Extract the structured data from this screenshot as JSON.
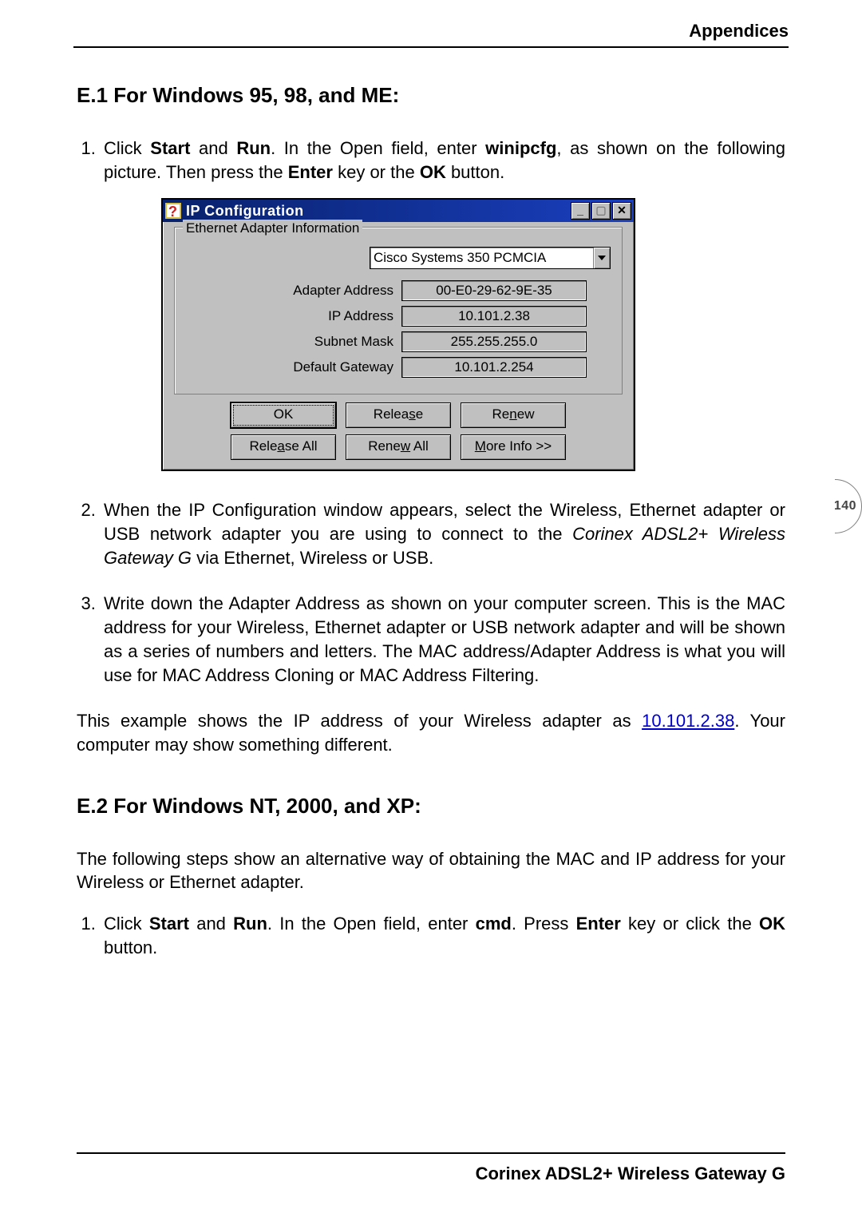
{
  "header": {
    "title": "Appendices"
  },
  "page_number": "140",
  "sections": {
    "e1": {
      "heading": "E.1 For Windows 95, 98, and ME:",
      "step1_pre": "Click ",
      "step1_start": "Start",
      "step1_and": " and ",
      "step1_run": "Run",
      "step1_mid": ". In the Open field, enter ",
      "step1_cmd": "winipcfg",
      "step1_tail": ", as shown on the following picture. Then press the ",
      "step1_enter": "Enter",
      "step1_tail2": " key or the ",
      "step1_ok": "OK",
      "step1_tail3": " button.",
      "step2_a": "When the IP Configuration window appears, select the Wireless, Ethernet adapter or USB network adapter you are using to connect to the ",
      "step2_em": "Corinex ADSL2+ Wireless Gateway G",
      "step2_b": " via Ethernet, Wireless or USB.",
      "step3": "Write down the Adapter Address as shown on your computer screen. This is the MAC address for your Wireless, Ethernet adapter or USB network adapter and will be shown as a series of numbers and letters. The MAC address/Adapter Address is what you will use for MAC Address Cloning or MAC Address Filtering.",
      "example_a": "This example shows the IP address of your Wireless adapter as ",
      "example_ip": "10.101.2.38",
      "example_b": ". Your computer may show something different."
    },
    "e2": {
      "heading": "E.2 For Windows NT, 2000, and XP:",
      "intro": "The following steps show an alternative way of obtaining the MAC and IP address for your Wireless or Ethernet adapter.",
      "step1_pre": "Click ",
      "step1_start": "Start",
      "step1_and": " and ",
      "step1_run": "Run",
      "step1_mid": ". In the Open field, enter ",
      "step1_cmd": "cmd",
      "step1_tail": ". Press ",
      "step1_enter": "Enter",
      "step1_tail2": " key or click the ",
      "step1_ok": "OK",
      "step1_tail3": " button."
    }
  },
  "dialog": {
    "title": "IP Configuration",
    "group_legend": "Ethernet Adapter Information",
    "adapter_selected": "Cisco Systems 350 PCMCIA",
    "fields": {
      "adapter_address": {
        "label": "Adapter Address",
        "value": "00-E0-29-62-9E-35"
      },
      "ip_address": {
        "label": "IP Address",
        "value": "10.101.2.38"
      },
      "subnet_mask": {
        "label": "Subnet Mask",
        "value": "255.255.255.0"
      },
      "default_gateway": {
        "label": "Default Gateway",
        "value": "10.101.2.254"
      }
    },
    "buttons": {
      "ok": "OK",
      "release": "Release",
      "renew": "Renew",
      "release_all": "Release All",
      "renew_all": "Renew All",
      "more_info": "More Info >>"
    }
  },
  "footer": {
    "text": "Corinex ADSL2+ Wireless Gateway G"
  }
}
